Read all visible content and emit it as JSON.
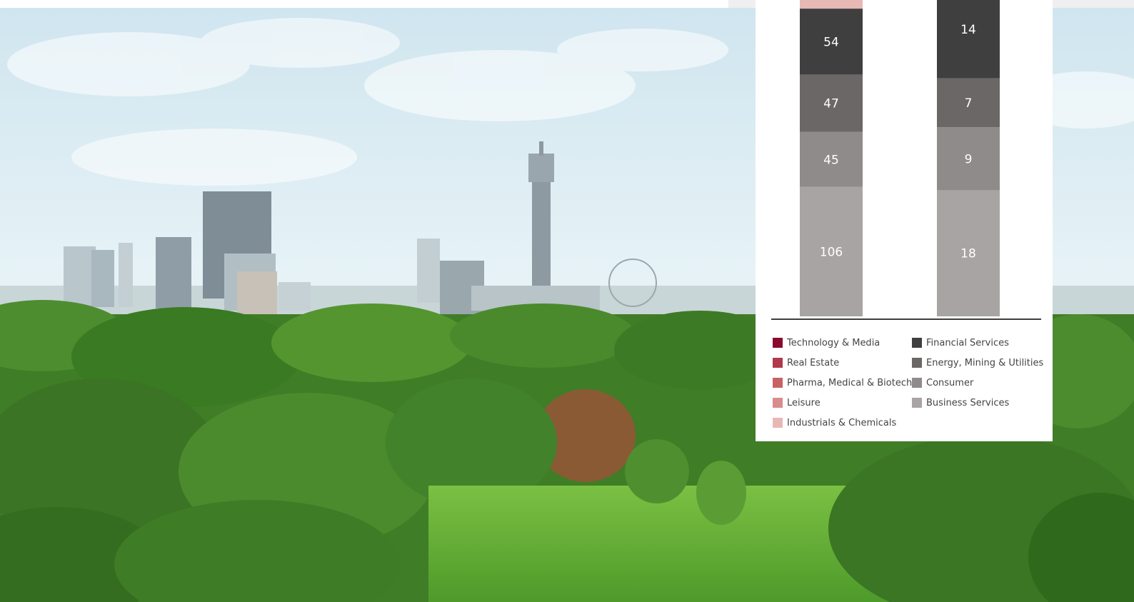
{
  "chart_data": {
    "type": "bar",
    "stacked": true,
    "categories": [
      "",
      ""
    ],
    "series": [
      {
        "name": "Business Services",
        "color": "#a8a4a3",
        "values": [
          106,
          18
        ]
      },
      {
        "name": "Consumer",
        "color": "#8f8b8a",
        "values": [
          45,
          9
        ]
      },
      {
        "name": "Energy, Mining & Utilities",
        "color": "#6b6766",
        "values": [
          47,
          7
        ]
      },
      {
        "name": "Financial Services",
        "color": "#3f3f3f",
        "values": [
          54,
          14
        ]
      },
      {
        "name": "Industrials & Chemicals",
        "color": "#e7b8b4",
        "values": [
          null,
          null
        ]
      },
      {
        "name": "Leisure",
        "color": "#d88c8c",
        "values": [
          null,
          null
        ]
      },
      {
        "name": "Pharma, Medical & Biotech",
        "color": "#c86164",
        "values": [
          null,
          null
        ]
      },
      {
        "name": "Real Estate",
        "color": "#b0394a",
        "values": [
          null,
          null
        ]
      },
      {
        "name": "Technology & Media",
        "color": "#8a0a2e",
        "values": [
          null,
          null
        ]
      }
    ],
    "data_labels": [
      [
        "106",
        "45",
        "47",
        "54"
      ],
      [
        "18",
        "9",
        "7",
        "14"
      ]
    ],
    "legend_left": [
      "Technology & Media",
      "Real Estate",
      "Pharma, Medical & Biotech",
      "Leisure",
      "Industrials & Chemicals"
    ],
    "legend_right": [
      "Financial Services",
      "Energy, Mining & Utilities",
      "Consumer",
      "Business Services"
    ],
    "legend_placement": "bottom",
    "grid": false
  },
  "legend": {
    "left": [
      {
        "label": "Technology & Media",
        "color": "#8a0a2e"
      },
      {
        "label": "Real Estate",
        "color": "#b0394a"
      },
      {
        "label": "Pharma, Medical & Biotech",
        "color": "#c86164"
      },
      {
        "label": "Leisure",
        "color": "#d88c8c"
      },
      {
        "label": "Industrials & Chemicals",
        "color": "#e7b8b4"
      }
    ],
    "right": [
      {
        "label": "Financial Services",
        "color": "#3f3f3f"
      },
      {
        "label": "Energy, Mining & Utilities",
        "color": "#6b6766"
      },
      {
        "label": "Consumer",
        "color": "#8f8b8a"
      },
      {
        "label": "Business Services",
        "color": "#a8a4a3"
      }
    ]
  }
}
